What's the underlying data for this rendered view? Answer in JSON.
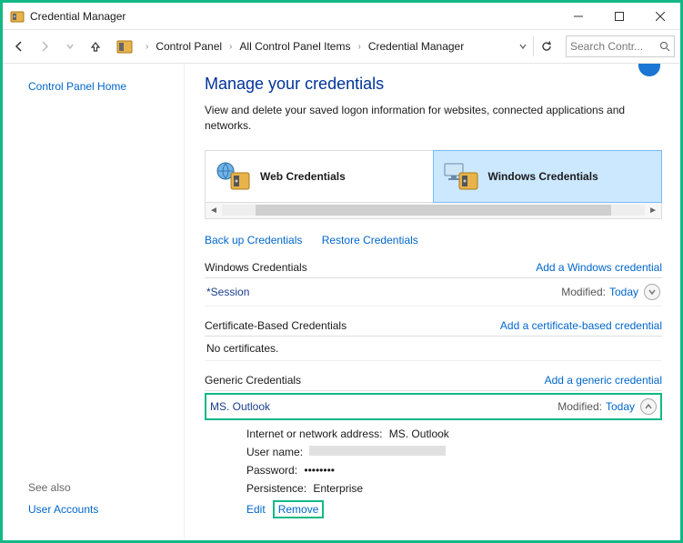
{
  "window": {
    "title": "Credential Manager"
  },
  "breadcrumb": {
    "items": [
      "Control Panel",
      "All Control Panel Items",
      "Credential Manager"
    ]
  },
  "search": {
    "placeholder": "Search Contr..."
  },
  "sidebar": {
    "home": "Control Panel Home",
    "see_also": "See also",
    "user_accounts": "User Accounts"
  },
  "page": {
    "title": "Manage your credentials",
    "desc": "View and delete your saved logon information for websites, connected applications and networks."
  },
  "tabs": {
    "web": "Web Credentials",
    "windows": "Windows Credentials"
  },
  "actions": {
    "backup": "Back up Credentials",
    "restore": "Restore Credentials"
  },
  "sections": {
    "windows": {
      "title": "Windows Credentials",
      "add": "Add a Windows credential"
    },
    "cert": {
      "title": "Certificate-Based Credentials",
      "add": "Add a certificate-based credential",
      "empty": "No certificates."
    },
    "generic": {
      "title": "Generic Credentials",
      "add": "Add a generic credential"
    }
  },
  "rows": {
    "session": {
      "name": "*Session",
      "mod_label": "Modified:",
      "mod_val": "Today"
    },
    "outlook": {
      "name": "MS. Outlook",
      "mod_label": "Modified:",
      "mod_val": "Today"
    }
  },
  "details": {
    "address_label": "Internet or network address:",
    "address_value": "MS. Outlook",
    "user_label": "User name:",
    "pass_label": "Password:",
    "pass_value": "••••••••",
    "persist_label": "Persistence:",
    "persist_value": "Enterprise",
    "edit": "Edit",
    "remove": "Remove"
  }
}
